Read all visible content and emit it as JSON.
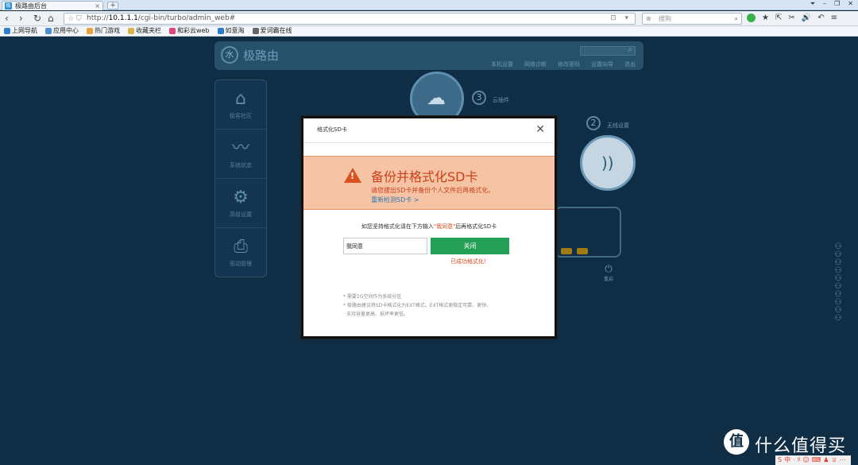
{
  "browser": {
    "tab_title": "极路由后台",
    "tab_favicon": "极",
    "tab_close": "×",
    "new_tab": "+",
    "window_controls": [
      "⏷",
      "–",
      "❐",
      "✕"
    ],
    "nav": {
      "back": "‹",
      "forward": "›",
      "reload": "↻",
      "home": "⌂"
    },
    "url_icons": "☆ ⛉",
    "url_prefix": "http://",
    "url_host": "10.1.1.1",
    "url_path": "/cgi-bin/turbo/admin_web#",
    "url_right_icons": "⊡ ▾",
    "search_placeholder": "搜狗",
    "search_icon": "⊛",
    "search_go": "⌕",
    "tools": [
      "★",
      "⇱",
      "✂",
      "🔊",
      "↶",
      "≡"
    ],
    "bookmarks": [
      {
        "label": "上网导航",
        "icon_color": "#2f7fcf"
      },
      {
        "label": "应用中心",
        "icon_color": "#4a8fd8"
      },
      {
        "label": "热门游戏",
        "icon_color": "#e6a23c"
      },
      {
        "label": "收藏夹栏",
        "icon_color": "#d9b44a"
      },
      {
        "label": "和彩云web",
        "icon_color": "#e0457b"
      },
      {
        "label": "如意淘",
        "icon_color": "#2a7ac8"
      },
      {
        "label": "爱词霸在线",
        "icon_color": "#666666"
      }
    ]
  },
  "router": {
    "logo_icon": "水",
    "logo_text": "极路由",
    "header_search_icon": "⌕",
    "header_nav": [
      "本机设置",
      "网络诊断",
      "修改密码",
      "设置向导",
      "退出"
    ],
    "sidebar": [
      {
        "icon": "⌂",
        "label": "极客社区"
      },
      {
        "icon": "〰",
        "label": "系统状态"
      },
      {
        "icon": "⚙",
        "label": "高级设置"
      },
      {
        "icon": "⎙",
        "label": "驱动管理"
      }
    ],
    "step3_icon": "☁",
    "step3_num": "3",
    "step3_label": "云插件",
    "step2_num": "2",
    "step2_label": "无线设置",
    "wifi_icon": "))",
    "reset_icon": "⏻",
    "reset_label": "重启",
    "right_dots": [
      "⚇",
      "⚇",
      "⚇",
      "⚇",
      "⚇",
      "⚇",
      "⚇",
      "⚇",
      "⚇",
      "⚇"
    ]
  },
  "modal": {
    "title": "格式化SD卡",
    "close_icon": "✕",
    "warning_symbol": "!",
    "alert_title": "备份并格式化SD卡",
    "alert_message": "请您拔出SD卡并备份个人文件后再格式化。",
    "alert_link": "重新检测SD卡 >",
    "instruction_before": "如您坚持格式化请在下方输入",
    "instruction_highlight": "\"我同意\"",
    "instruction_after": "后再格式化SD卡",
    "input_value": "我同意",
    "button_label": "关闭",
    "success_message": "已成功格式化！",
    "notes": [
      "* 需要1G空间作为系统分区",
      "* 极路由建议将SD卡格式化为EXT格式。EXT格式更稳定可靠、更快、",
      "  支持容量更高、损坏率更低。"
    ]
  },
  "watermark": {
    "circle_text": "值",
    "text": "什么值得买",
    "ime": "S中·º☺⌨♟♕⋯"
  }
}
